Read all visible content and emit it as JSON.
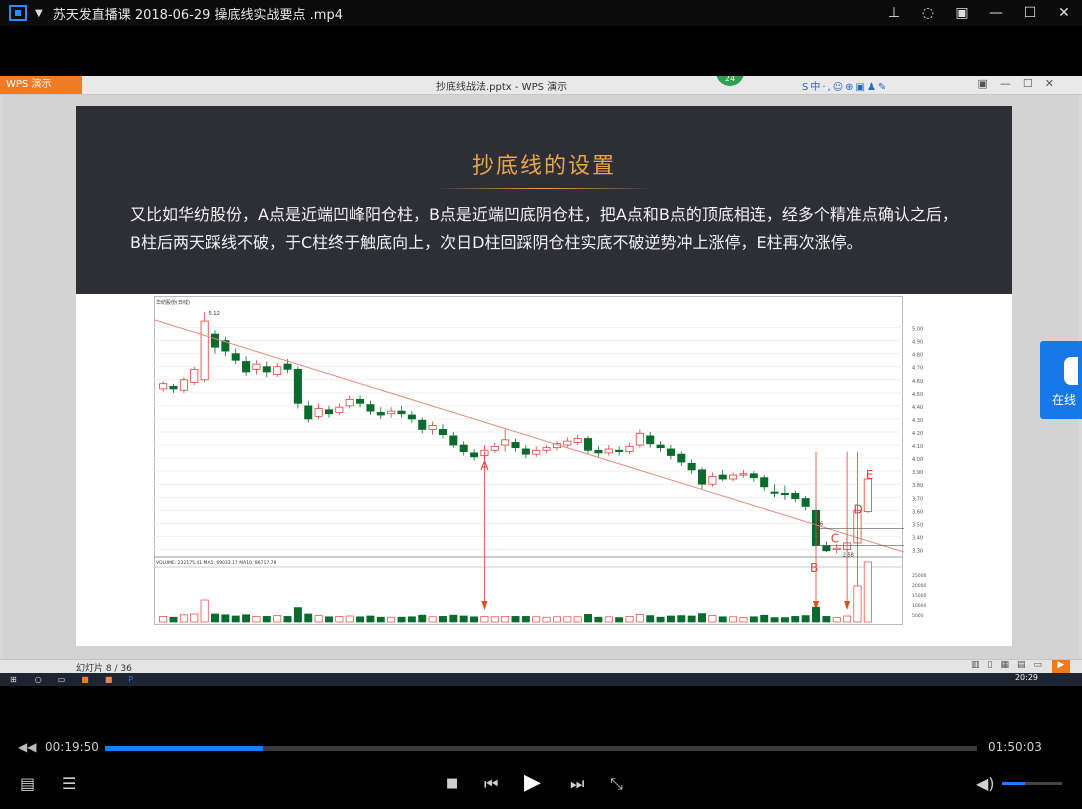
{
  "player": {
    "title": "苏天发直播课 2018-06-29 操底线实战要点 .mp4",
    "current_time": "00:19:50",
    "duration": "01:50:03",
    "progress_fraction": 0.181,
    "volume_fraction": 0.38,
    "accent_color": "#1a7cff"
  },
  "wps": {
    "tab_label": "WPS 演示",
    "file_title": "抄底线战法.pptx - WPS 演示",
    "badge": "24",
    "slide_counter": "幻灯片 8 / 36"
  },
  "slide": {
    "title": "抄底线的设置",
    "body": "又比如华纺股份，A点是近端凹峰阳仓柱，B点是近端凹底阴仓柱，把A点和B点的顶底相连，经多个精准点确认之后，B柱后两天踩线不破，于C柱终于触底向上，次日D柱回踩阴仓柱实底不破逆势冲上涨停，E柱再次涨停。"
  },
  "taskbar": {
    "clock": "20:29"
  },
  "sidewidget": {
    "label": "在线"
  },
  "chart_data": {
    "type": "candlestick",
    "stock_label": "华纺股份(日线)",
    "high_label": "5.12",
    "price_ticks": [
      "5.00",
      "4.90",
      "4.80",
      "4.70",
      "4.60",
      "4.50",
      "4.40",
      "4.30",
      "4.20",
      "4.10",
      "4.00",
      "3.90",
      "3.80",
      "3.70",
      "3.60",
      "3.50",
      "3.40",
      "3.30"
    ],
    "ylim": [
      3.25,
      5.15
    ],
    "point_labels": [
      "A",
      "B",
      "C",
      "D",
      "E"
    ],
    "annotations": [
      "3.46",
      "2.58"
    ],
    "volume_legend": "VOLUME: 232175.41   MA5: 69033.17   MA10: 86717.79",
    "volume_ticks": [
      "25000",
      "20000",
      "15000",
      "10000",
      "5000"
    ],
    "candles": [
      [
        4.53,
        4.57,
        4.59,
        4.51
      ],
      [
        4.55,
        4.53,
        4.57,
        4.5
      ],
      [
        4.52,
        4.6,
        4.62,
        4.5
      ],
      [
        4.58,
        4.68,
        4.7,
        4.56
      ],
      [
        4.6,
        5.05,
        5.12,
        4.58
      ],
      [
        4.95,
        4.85,
        4.98,
        4.8
      ],
      [
        4.9,
        4.82,
        4.93,
        4.78
      ],
      [
        4.8,
        4.75,
        4.84,
        4.72
      ],
      [
        4.74,
        4.66,
        4.78,
        4.63
      ],
      [
        4.68,
        4.72,
        4.75,
        4.64
      ],
      [
        4.7,
        4.66,
        4.74,
        4.62
      ],
      [
        4.64,
        4.7,
        4.73,
        4.62
      ],
      [
        4.72,
        4.68,
        4.76,
        4.65
      ],
      [
        4.68,
        4.42,
        4.7,
        4.38
      ],
      [
        4.4,
        4.3,
        4.44,
        4.27
      ],
      [
        4.32,
        4.38,
        4.42,
        4.3
      ],
      [
        4.37,
        4.34,
        4.4,
        4.31
      ],
      [
        4.35,
        4.39,
        4.42,
        4.33
      ],
      [
        4.4,
        4.45,
        4.48,
        4.38
      ],
      [
        4.45,
        4.42,
        4.48,
        4.39
      ],
      [
        4.41,
        4.36,
        4.44,
        4.33
      ],
      [
        4.35,
        4.33,
        4.39,
        4.3
      ],
      [
        4.34,
        4.36,
        4.39,
        4.31
      ],
      [
        4.36,
        4.34,
        4.4,
        4.31
      ],
      [
        4.33,
        4.3,
        4.36,
        4.27
      ],
      [
        4.29,
        4.22,
        4.31,
        4.19
      ],
      [
        4.22,
        4.25,
        4.28,
        4.18
      ],
      [
        4.22,
        4.18,
        4.26,
        4.15
      ],
      [
        4.17,
        4.1,
        4.2,
        4.08
      ],
      [
        4.1,
        4.05,
        4.13,
        4.02
      ],
      [
        4.04,
        4.01,
        4.07,
        3.98
      ],
      [
        4.02,
        4.06,
        4.1,
        3.99
      ],
      [
        4.06,
        4.09,
        4.12,
        4.04
      ],
      [
        4.1,
        4.14,
        4.22,
        4.05
      ],
      [
        4.12,
        4.08,
        4.15,
        4.05
      ],
      [
        4.07,
        4.03,
        4.1,
        4.0
      ],
      [
        4.03,
        4.06,
        4.09,
        4.01
      ],
      [
        4.06,
        4.08,
        4.1,
        4.04
      ],
      [
        4.08,
        4.11,
        4.13,
        4.06
      ],
      [
        4.1,
        4.13,
        4.16,
        4.08
      ],
      [
        4.12,
        4.15,
        4.18,
        4.1
      ],
      [
        4.15,
        4.06,
        4.17,
        4.03
      ],
      [
        4.06,
        4.04,
        4.09,
        4.01
      ],
      [
        4.04,
        4.07,
        4.1,
        4.02
      ],
      [
        4.06,
        4.05,
        4.09,
        4.02
      ],
      [
        4.05,
        4.09,
        4.12,
        4.03
      ],
      [
        4.1,
        4.19,
        4.22,
        4.08
      ],
      [
        4.17,
        4.11,
        4.2,
        4.08
      ],
      [
        4.1,
        4.08,
        4.13,
        4.05
      ],
      [
        4.07,
        4.02,
        4.1,
        3.99
      ],
      [
        4.03,
        3.97,
        4.05,
        3.94
      ],
      [
        3.96,
        3.91,
        3.99,
        3.88
      ],
      [
        3.91,
        3.8,
        3.93,
        3.76
      ],
      [
        3.8,
        3.86,
        3.89,
        3.78
      ],
      [
        3.87,
        3.84,
        3.91,
        3.82
      ],
      [
        3.84,
        3.87,
        3.89,
        3.82
      ],
      [
        3.87,
        3.88,
        3.91,
        3.85
      ],
      [
        3.88,
        3.85,
        3.9,
        3.82
      ],
      [
        3.85,
        3.78,
        3.87,
        3.75
      ],
      [
        3.74,
        3.73,
        3.8,
        3.7
      ],
      [
        3.73,
        3.72,
        3.79,
        3.68
      ],
      [
        3.73,
        3.69,
        3.75,
        3.66
      ],
      [
        3.69,
        3.63,
        3.71,
        3.6
      ],
      [
        3.6,
        3.33,
        3.62,
        3.31
      ],
      [
        3.33,
        3.29,
        3.36,
        3.28
      ],
      [
        3.3,
        3.31,
        3.34,
        3.27
      ],
      [
        3.3,
        3.35,
        3.4,
        3.28
      ],
      [
        3.35,
        3.6,
        3.62,
        3.34
      ],
      [
        3.59,
        3.84,
        3.86,
        3.58
      ]
    ]
  }
}
